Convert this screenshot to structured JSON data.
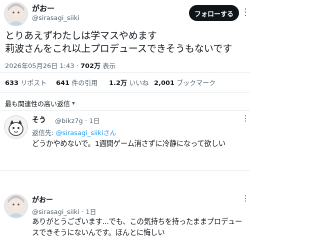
{
  "post": {
    "author": {
      "name": "がおー",
      "handle": "@sirasagi_siiki"
    },
    "follow_label": "フォローする",
    "more_icon": "more-icon",
    "text_lines": [
      "とりあえずわたしは学マスやめます",
      "莉波さんをこれ以上プロデュースできそうもないです"
    ],
    "meta": {
      "datetime": "2026年05月26日 1:43",
      "views_count": "702万",
      "views_label": "表示"
    },
    "stats": [
      {
        "count": "633",
        "label": "リポスト"
      },
      {
        "count": "641",
        "label": "件の引用"
      },
      {
        "count": "1.2万",
        "label": "いいね"
      },
      {
        "count": "2,001",
        "label": "ブックマーク"
      }
    ]
  },
  "replies_sort": {
    "label": "最も関連性の高い返信",
    "icon": "chevron-down-icon"
  },
  "replies": [
    {
      "name": "そう",
      "handle": "@bikz7g",
      "time": "1日",
      "reply_to_prefix": "返信先:",
      "reply_to_handle": "@sirasagi_siiki",
      "reply_to_suffix": "さん",
      "body_lines": [
        "どうかやめないで。1週間ゲーム消さずに冷静になって欲しい"
      ]
    },
    {
      "name": "がおー",
      "handle": "@sirasagi_siiki",
      "time": "1日",
      "reply_to_prefix": "",
      "reply_to_handle": "",
      "reply_to_suffix": "",
      "body_lines": [
        "ありがとうございます...でも、この気持ちを持ったままプロデュー",
        "スできそうにないんです。ほんとに悔しい"
      ]
    }
  ]
}
